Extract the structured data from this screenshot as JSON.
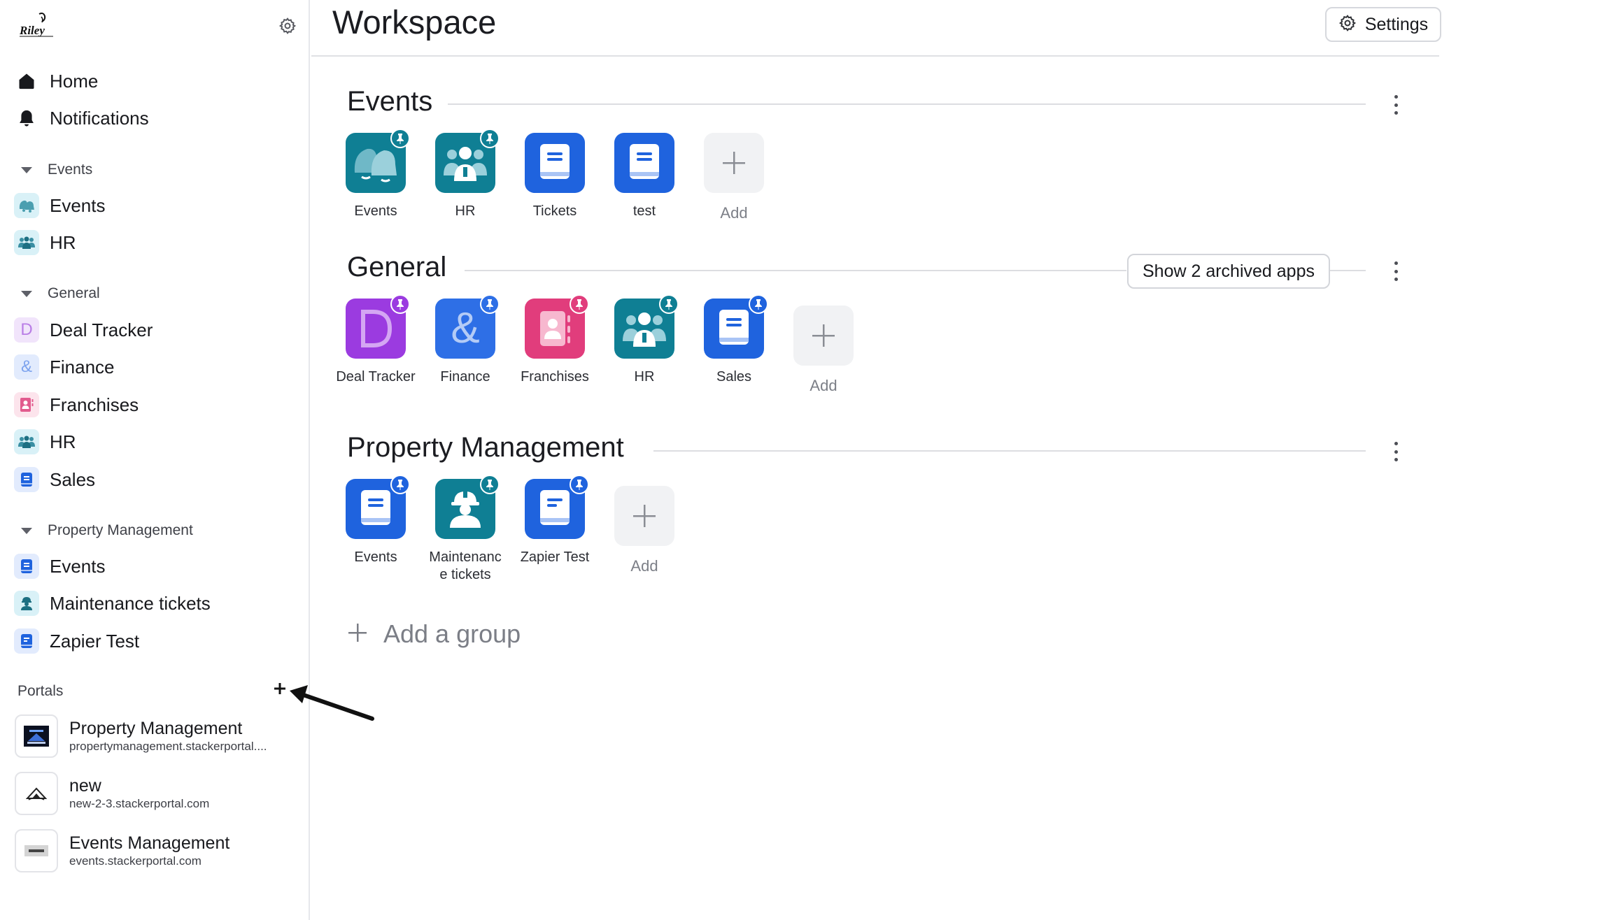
{
  "page": {
    "title": "Workspace",
    "settings_label": "Settings"
  },
  "sidebar": {
    "top_items": [
      {
        "label": "Home",
        "icon": "home-icon"
      },
      {
        "label": "Notifications",
        "icon": "bell-icon"
      }
    ],
    "groups": [
      {
        "label": "Events",
        "items": [
          {
            "label": "Events",
            "icon": "bells-icon",
            "bg": "#d9f1f7"
          },
          {
            "label": "HR",
            "icon": "people-icon",
            "bg": "#d9f1f7"
          }
        ]
      },
      {
        "label": "General",
        "items": [
          {
            "label": "Deal Tracker",
            "icon": "letter-d-icon",
            "bg": "#f1e4fb",
            "glyph": "D"
          },
          {
            "label": "Finance",
            "icon": "ampersand-icon",
            "bg": "#e2ebfd",
            "glyph": "&"
          },
          {
            "label": "Franchises",
            "icon": "contact-card-icon",
            "bg": "#fce4ec"
          },
          {
            "label": "HR",
            "icon": "people-icon",
            "bg": "#d9f1f7"
          },
          {
            "label": "Sales",
            "icon": "book-icon",
            "bg": "#e2ebfd"
          }
        ]
      },
      {
        "label": "Property Management",
        "items": [
          {
            "label": "Events",
            "icon": "book-icon",
            "bg": "#e2ebfd"
          },
          {
            "label": "Maintenance tickets",
            "icon": "worker-icon",
            "bg": "#d9f1f7"
          },
          {
            "label": "Zapier Test",
            "icon": "book-icon",
            "bg": "#e2ebfd"
          }
        ]
      }
    ],
    "portals_label": "Portals",
    "portals": [
      {
        "name": "Property Management",
        "url": "propertymanagement.stackerportal...."
      },
      {
        "name": "new",
        "url": "new-2-3.stackerportal.com"
      },
      {
        "name": "Events Management",
        "url": "events.stackerportal.com"
      }
    ]
  },
  "groups": [
    {
      "title": "Events",
      "apps": [
        {
          "name": "Events",
          "icon": "bells-icon",
          "color": "#0f7f94",
          "pin": true
        },
        {
          "name": "HR",
          "icon": "people-icon",
          "color": "#0f7f94",
          "pin": true
        },
        {
          "name": "Tickets",
          "icon": "book-icon",
          "color": "#1f63de",
          "pin": false
        },
        {
          "name": "test",
          "icon": "book-icon",
          "color": "#1f63de",
          "pin": false
        }
      ],
      "add_label": "Add"
    },
    {
      "title": "General",
      "archived_label": "Show 2 archived apps",
      "apps": [
        {
          "name": "Deal Tracker",
          "icon": "letter-d-icon",
          "color": "#9b3be0",
          "pin": true
        },
        {
          "name": "Finance",
          "icon": "ampersand-icon",
          "color": "#2e6fe6",
          "pin": true
        },
        {
          "name": "Franchises",
          "icon": "contact-card-icon",
          "color": "#e13d7c",
          "pin": true
        },
        {
          "name": "HR",
          "icon": "people-icon",
          "color": "#0f7f94",
          "pin": true
        },
        {
          "name": "Sales",
          "icon": "book-icon",
          "color": "#1f63de",
          "pin": true
        }
      ],
      "add_label": "Add"
    },
    {
      "title": "Property Management",
      "apps": [
        {
          "name": "Events",
          "icon": "book-icon",
          "color": "#1f63de",
          "pin": true
        },
        {
          "name": "Maintenanc e tickets",
          "icon": "worker-icon",
          "color": "#0f7f94",
          "pin": true
        },
        {
          "name": "Zapier Test",
          "icon": "book-icon",
          "color": "#1f63de",
          "pin": true
        }
      ],
      "add_label": "Add"
    }
  ],
  "add_group_label": "Add a group",
  "colors": {
    "teal": "#0f7f94",
    "blue": "#1f63de",
    "purple": "#9b3be0",
    "pink": "#e13d7c"
  }
}
